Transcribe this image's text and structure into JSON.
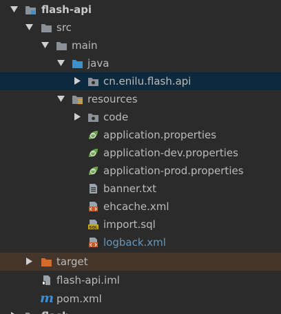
{
  "tree": {
    "root": {
      "label": "flash-api"
    },
    "src": {
      "label": "src"
    },
    "main": {
      "label": "main"
    },
    "java": {
      "label": "java"
    },
    "package": {
      "label": "cn.enilu.flash.api"
    },
    "resources": {
      "label": "resources"
    },
    "code": {
      "label": "code"
    },
    "files": [
      {
        "label": "application.properties",
        "icon": "spring-leaf-icon"
      },
      {
        "label": "application-dev.properties",
        "icon": "spring-leaf-icon"
      },
      {
        "label": "application-prod.properties",
        "icon": "spring-leaf-icon"
      },
      {
        "label": "banner.txt",
        "icon": "text-file-icon"
      },
      {
        "label": "ehcache.xml",
        "icon": "xml-file-icon"
      },
      {
        "label": "import.sql",
        "icon": "sql-file-icon"
      },
      {
        "label": "logback.xml",
        "icon": "xml-file-icon"
      }
    ],
    "target": {
      "label": "target"
    },
    "iml": {
      "label": "flash-api.iml"
    },
    "pom": {
      "label": "pom.xml",
      "icon_glyph": "m"
    },
    "next_partial": {
      "label": "flash"
    }
  },
  "colors": {
    "background": "#2b2b2b",
    "selected_row": "#0d293e",
    "target_row": "#45362b",
    "folder_gray": "#8a9199",
    "folder_blue": "#3f8fc8",
    "folder_orange": "#d96a2a",
    "spring_green": "#6ba54a",
    "maven_blue": "#3a8fd9",
    "link_blue": "#6897bb"
  }
}
